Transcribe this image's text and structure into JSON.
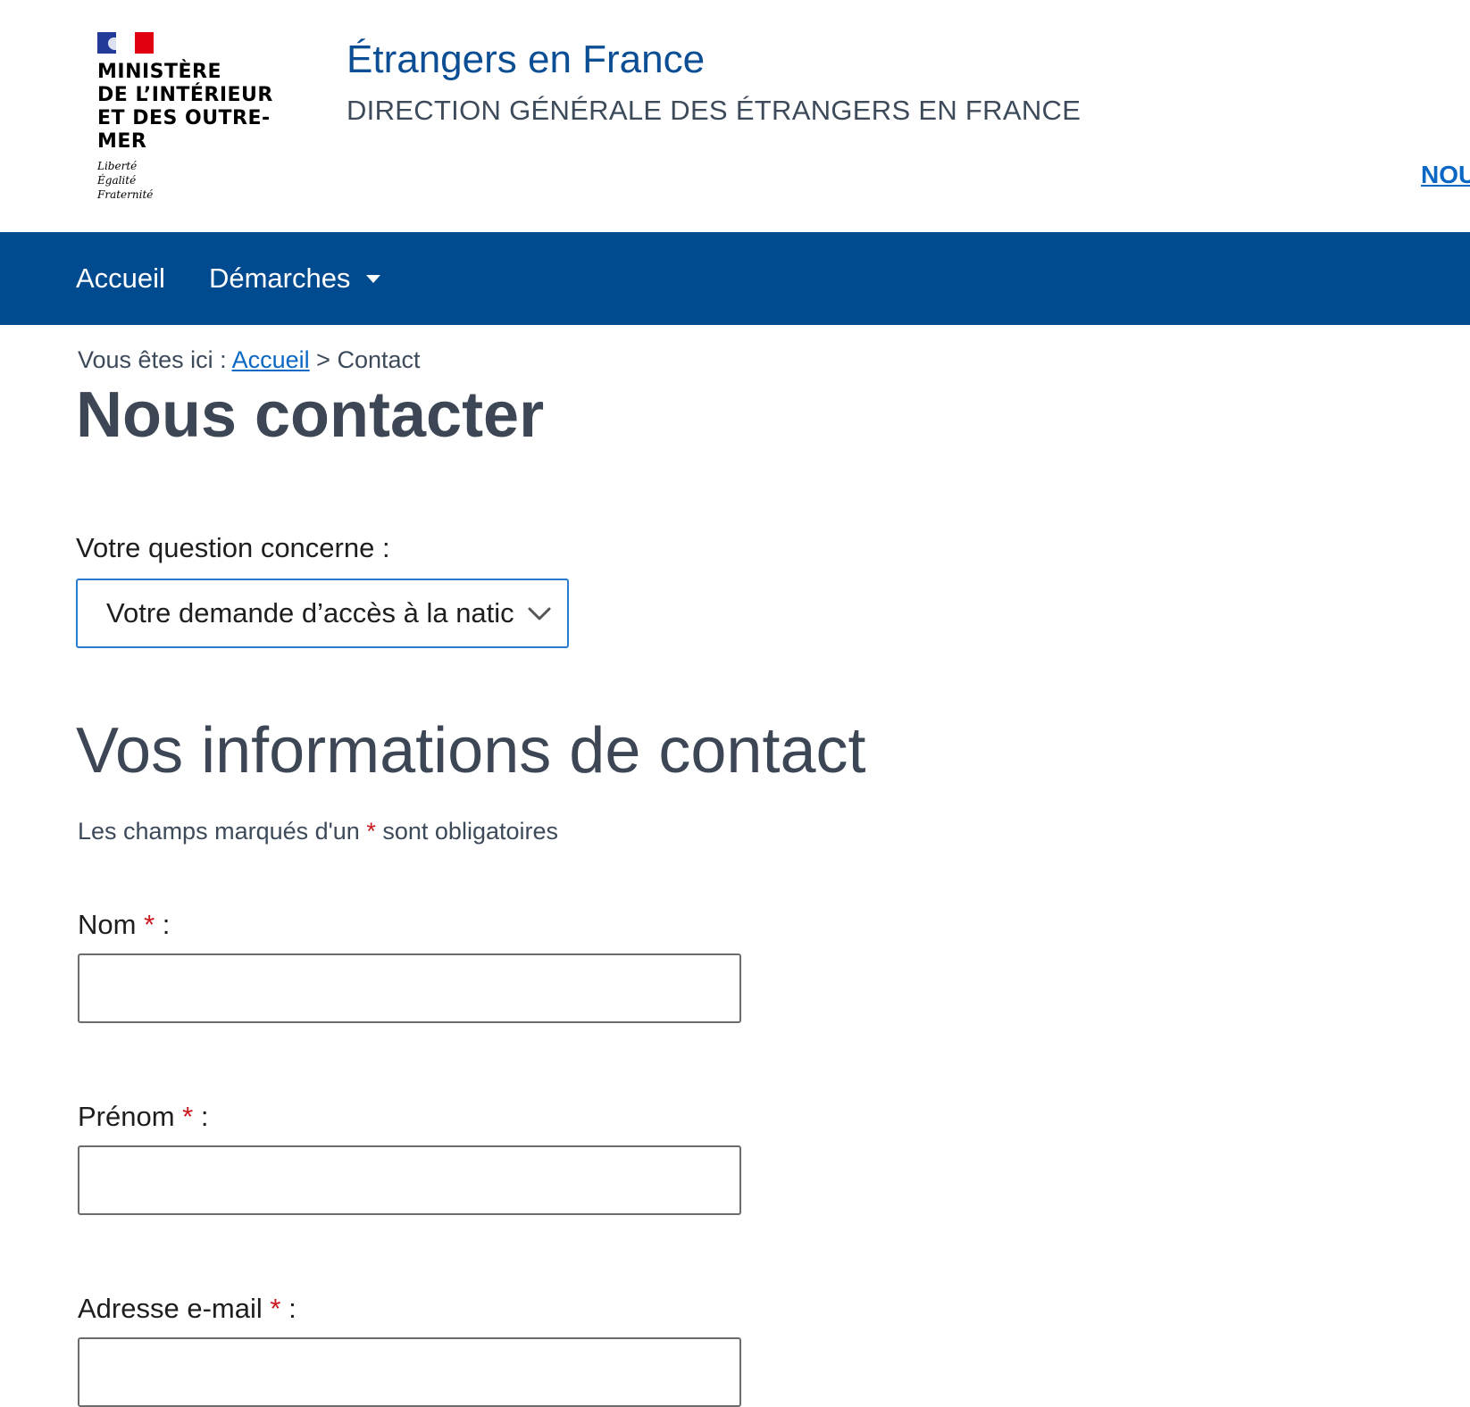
{
  "header": {
    "ministry_lines": "MINISTÈRE\nDE L’INTÉRIEUR\nET DES OUTRE-MER",
    "motto": "Liberté\nÉgalité\nFraternité",
    "site_title": "Étrangers en France",
    "site_subtitle": "DIRECTION GÉNÉRALE DES ÉTRANGERS EN FRANCE",
    "top_link": "NOU"
  },
  "nav": {
    "items": [
      {
        "label": "Accueil"
      },
      {
        "label": "Démarches"
      }
    ]
  },
  "breadcrumb": {
    "prefix": "Vous êtes ici :",
    "home": "Accueil",
    "separator": ">",
    "current": "Contact"
  },
  "page_title": "Nous contacter",
  "question": {
    "label": "Votre question concerne :",
    "selected": "Votre demande d’accès à la natic"
  },
  "contact_section": {
    "title": "Vos informations de contact",
    "note_before": "Les champs marqués d'un",
    "note_star": "*",
    "note_after": "sont obligatoires",
    "fields": [
      {
        "label": "Nom",
        "star": "*",
        "colon": ":",
        "value": ""
      },
      {
        "label": "Prénom",
        "star": "*",
        "colon": ":",
        "value": ""
      },
      {
        "label": "Adresse e-mail",
        "star": "*",
        "colon": ":",
        "value": ""
      }
    ]
  },
  "colors": {
    "nav_background": "#004b90",
    "title_blue": "#0b4e94",
    "link_blue": "#0b67c4",
    "required_red": "#c9191e"
  }
}
